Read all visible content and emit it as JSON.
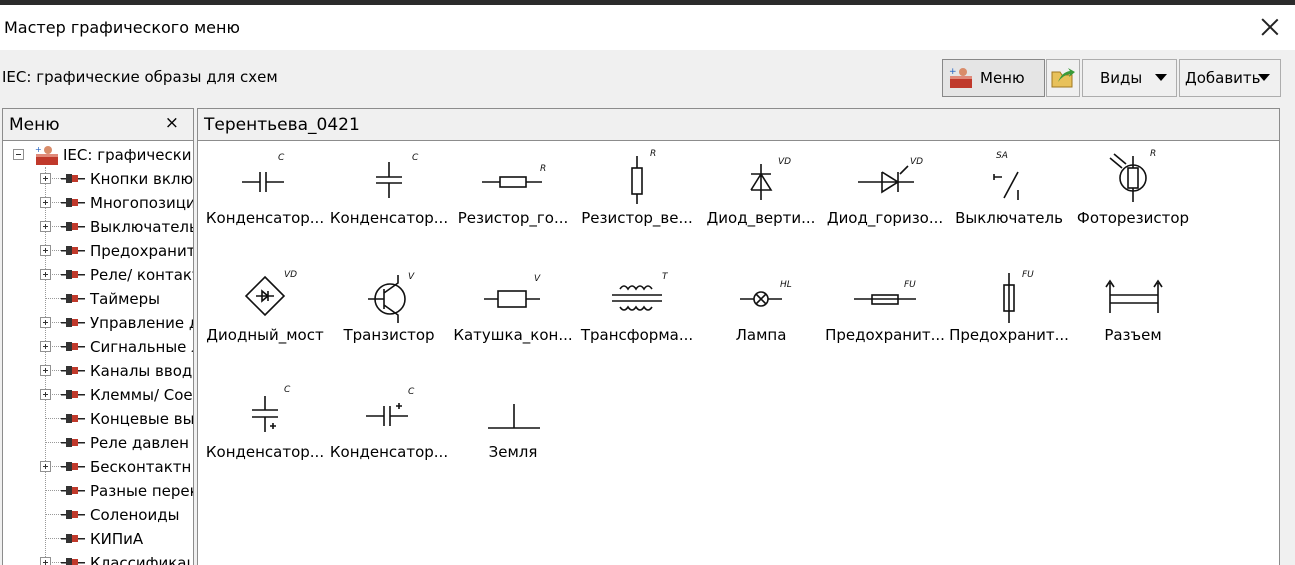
{
  "window": {
    "title": "Мастер графического меню"
  },
  "header": {
    "subtitle": "IEC: графические образы для схем"
  },
  "toolbar": {
    "menu_label": "Меню",
    "views_label": "Виды",
    "add_label": "Добавить"
  },
  "menu_panel": {
    "title": "Меню",
    "close_glyph": "×",
    "root_label": "IEC: графически",
    "items": [
      "Кнопки включ",
      "Многопозици",
      "Выключатель",
      "Предохранит",
      "Реле/ контакт",
      "Таймеры",
      "Управление д",
      "Сигнальные л",
      "Каналы ввод",
      "Клеммы/ Сое",
      "Концевые вы",
      "Реле давлен",
      "Бесконтактн",
      "Разные перек",
      "Соленоиды",
      "КИПиА",
      "Классификац"
    ]
  },
  "content": {
    "title": "Терентьева_0421",
    "symbols": [
      {
        "label": "Конденсатор...",
        "icon": "capacitor-h-icon",
        "tag": "C"
      },
      {
        "label": "Конденсатор...",
        "icon": "capacitor-v-icon",
        "tag": "C"
      },
      {
        "label": "Резистор_го...",
        "icon": "resistor-h-icon",
        "tag": "R"
      },
      {
        "label": "Резистор_ве...",
        "icon": "resistor-v-icon",
        "tag": "R"
      },
      {
        "label": "Диод_верти...",
        "icon": "diode-v-icon",
        "tag": "VD"
      },
      {
        "label": "Диод_горизо...",
        "icon": "diode-h-icon",
        "tag": "VD"
      },
      {
        "label": "Выключатель",
        "icon": "switch-icon",
        "tag": "SA"
      },
      {
        "label": "Фоторезистор",
        "icon": "photoresistor-icon",
        "tag": "R"
      },
      {
        "label": "Диодный_мост",
        "icon": "diode-bridge-icon",
        "tag": "VD"
      },
      {
        "label": "Транзистор",
        "icon": "transistor-icon",
        "tag": "V"
      },
      {
        "label": "Катушка_кон...",
        "icon": "coil-icon",
        "tag": "V"
      },
      {
        "label": "Трансформа...",
        "icon": "transformer-icon",
        "tag": "T"
      },
      {
        "label": "Лампа",
        "icon": "lamp-icon",
        "tag": "HL"
      },
      {
        "label": "Предохранит...",
        "icon": "fuse-h-icon",
        "tag": "FU"
      },
      {
        "label": "Предохранит...",
        "icon": "fuse-v-icon",
        "tag": "FU"
      },
      {
        "label": "Разъем",
        "icon": "connector-icon",
        "tag": ""
      },
      {
        "label": "Конденсатор...",
        "icon": "capacitor-polar-v-icon",
        "tag": "C"
      },
      {
        "label": "Конденсатор...",
        "icon": "capacitor-polar-h-icon",
        "tag": "C"
      },
      {
        "label": "Земля",
        "icon": "ground-icon",
        "tag": ""
      }
    ]
  }
}
